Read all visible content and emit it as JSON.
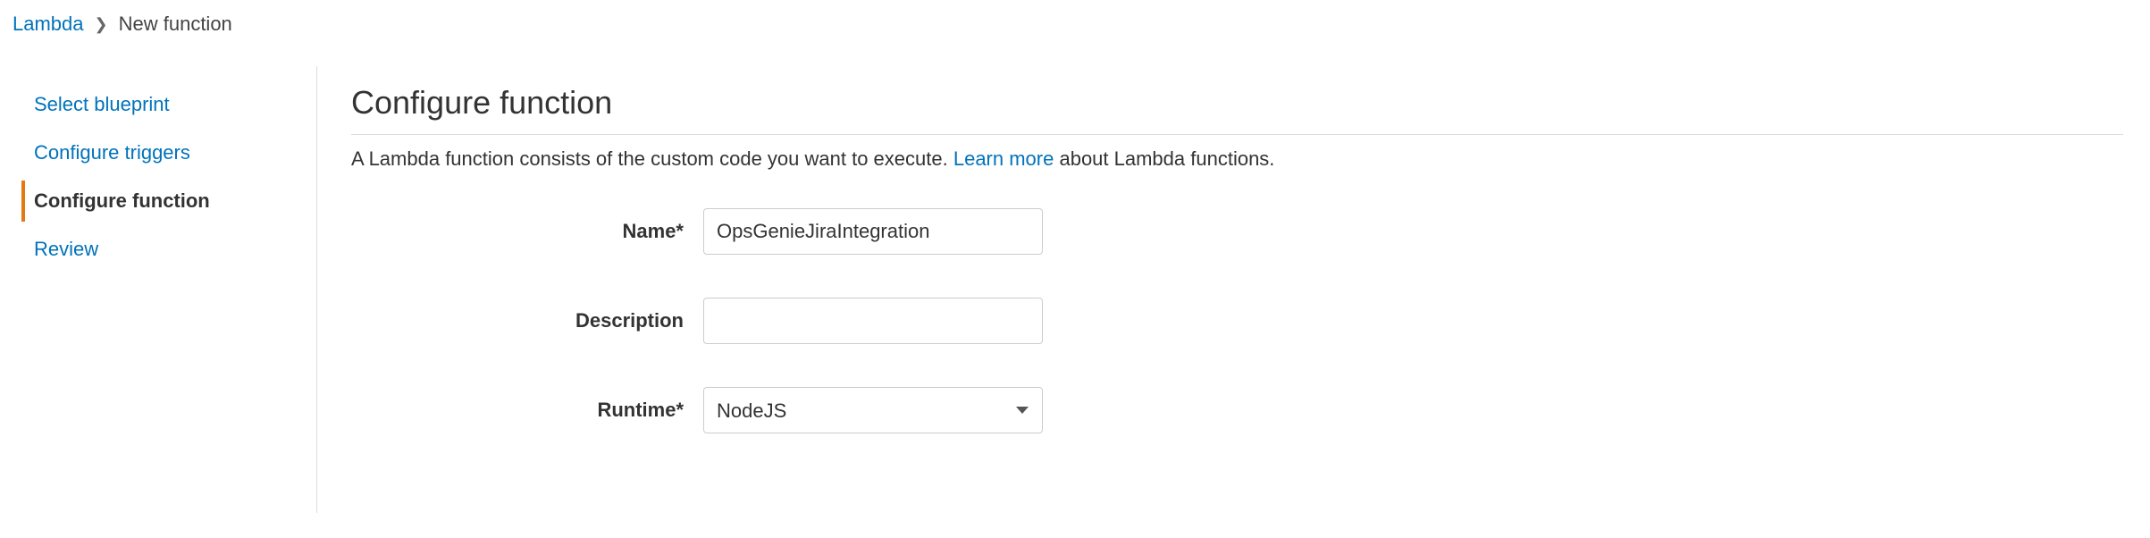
{
  "breadcrumb": {
    "root": "Lambda",
    "current": "New function"
  },
  "sidebar": {
    "items": [
      {
        "label": "Select blueprint",
        "active": false
      },
      {
        "label": "Configure triggers",
        "active": false
      },
      {
        "label": "Configure function",
        "active": true
      },
      {
        "label": "Review",
        "active": false
      }
    ]
  },
  "main": {
    "title": "Configure function",
    "description_pre": "A Lambda function consists of the custom code you want to execute. ",
    "learn_more": "Learn more",
    "description_post": " about Lambda functions."
  },
  "form": {
    "name": {
      "label": "Name*",
      "value": "OpsGenieJiraIntegration"
    },
    "description": {
      "label": "Description",
      "value": ""
    },
    "runtime": {
      "label": "Runtime*",
      "value": "NodeJS"
    }
  }
}
